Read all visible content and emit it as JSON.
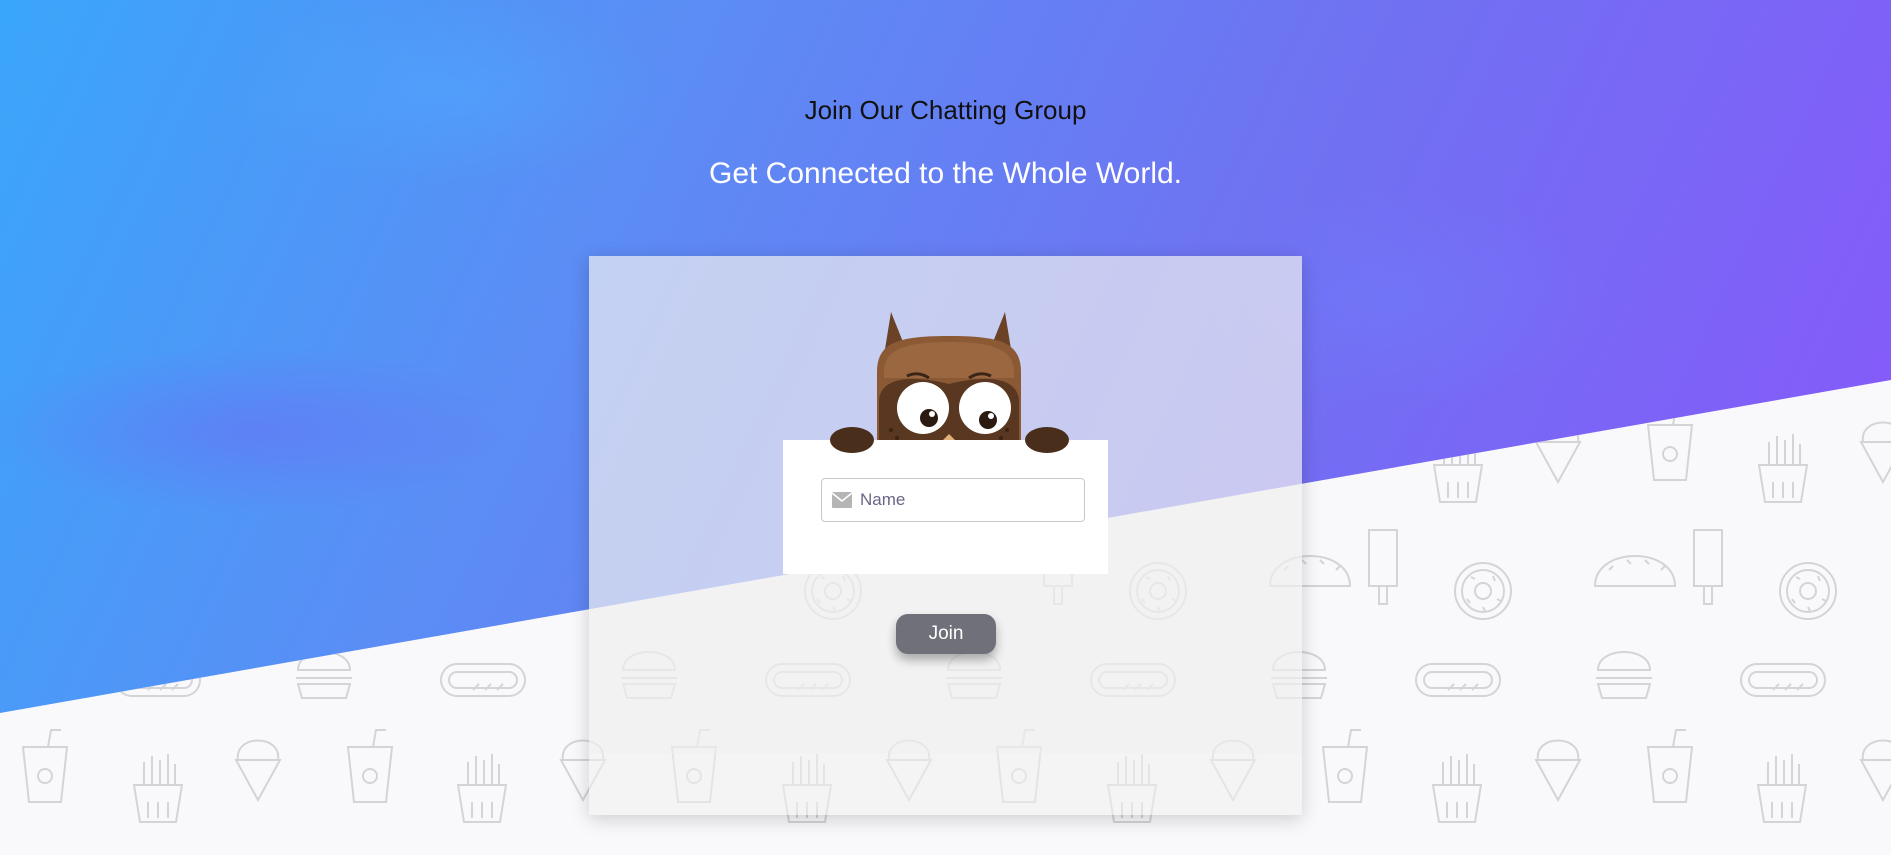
{
  "header": {
    "title": "Join Our Chatting Group",
    "subtitle": "Get Connected to the Whole World."
  },
  "form": {
    "name_placeholder": "Name",
    "name_value": "",
    "join_label": "Join"
  },
  "icons": {
    "field_icon": "envelope-icon",
    "mascot": "owl-icon"
  },
  "colors": {
    "gradient_start": "#3aa6fb",
    "gradient_end": "#8a55fb",
    "button": "#6f7079",
    "title_text": "#111111",
    "subtitle_text": "#ffffff"
  }
}
